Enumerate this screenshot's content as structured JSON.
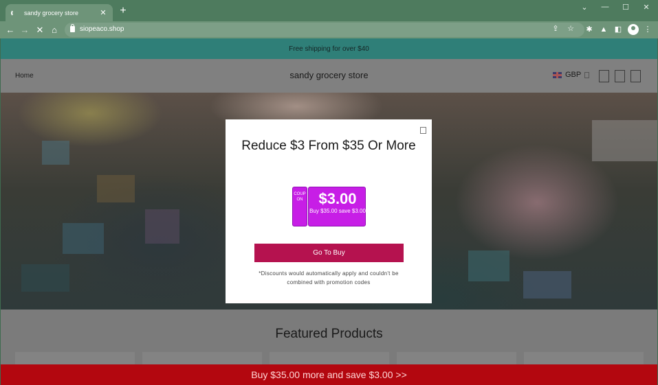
{
  "browser": {
    "tab_title": "sandy grocery store",
    "tab_close": "✕",
    "new_tab": "+",
    "url": "siopeaco.shop",
    "window_controls": [
      "⌄",
      "—",
      "☐",
      "✕"
    ]
  },
  "store": {
    "announcement": "Free shipping for over $40",
    "nav_home": "Home",
    "site_title": "sandy grocery store",
    "currency": "GBP",
    "featured_title": "Featured Products"
  },
  "modal": {
    "title": "Reduce $3 From $35 Or More",
    "coupon_side": "COUPON",
    "coupon_amount": "$3.00",
    "coupon_desc": "Buy $35.00 save $3.00",
    "button": "Go To Buy",
    "disclaimer": "*Discounts would automatically apply and couldn't be combined with promotion codes"
  },
  "promo_bar": {
    "text": "Buy $35.00 more and save $3.00  >>"
  },
  "colors": {
    "brand_button": "#b5124f",
    "coupon": "#c71ee6",
    "promo_bar": "#b3070f",
    "announcement_bar": "#2f7f78"
  }
}
